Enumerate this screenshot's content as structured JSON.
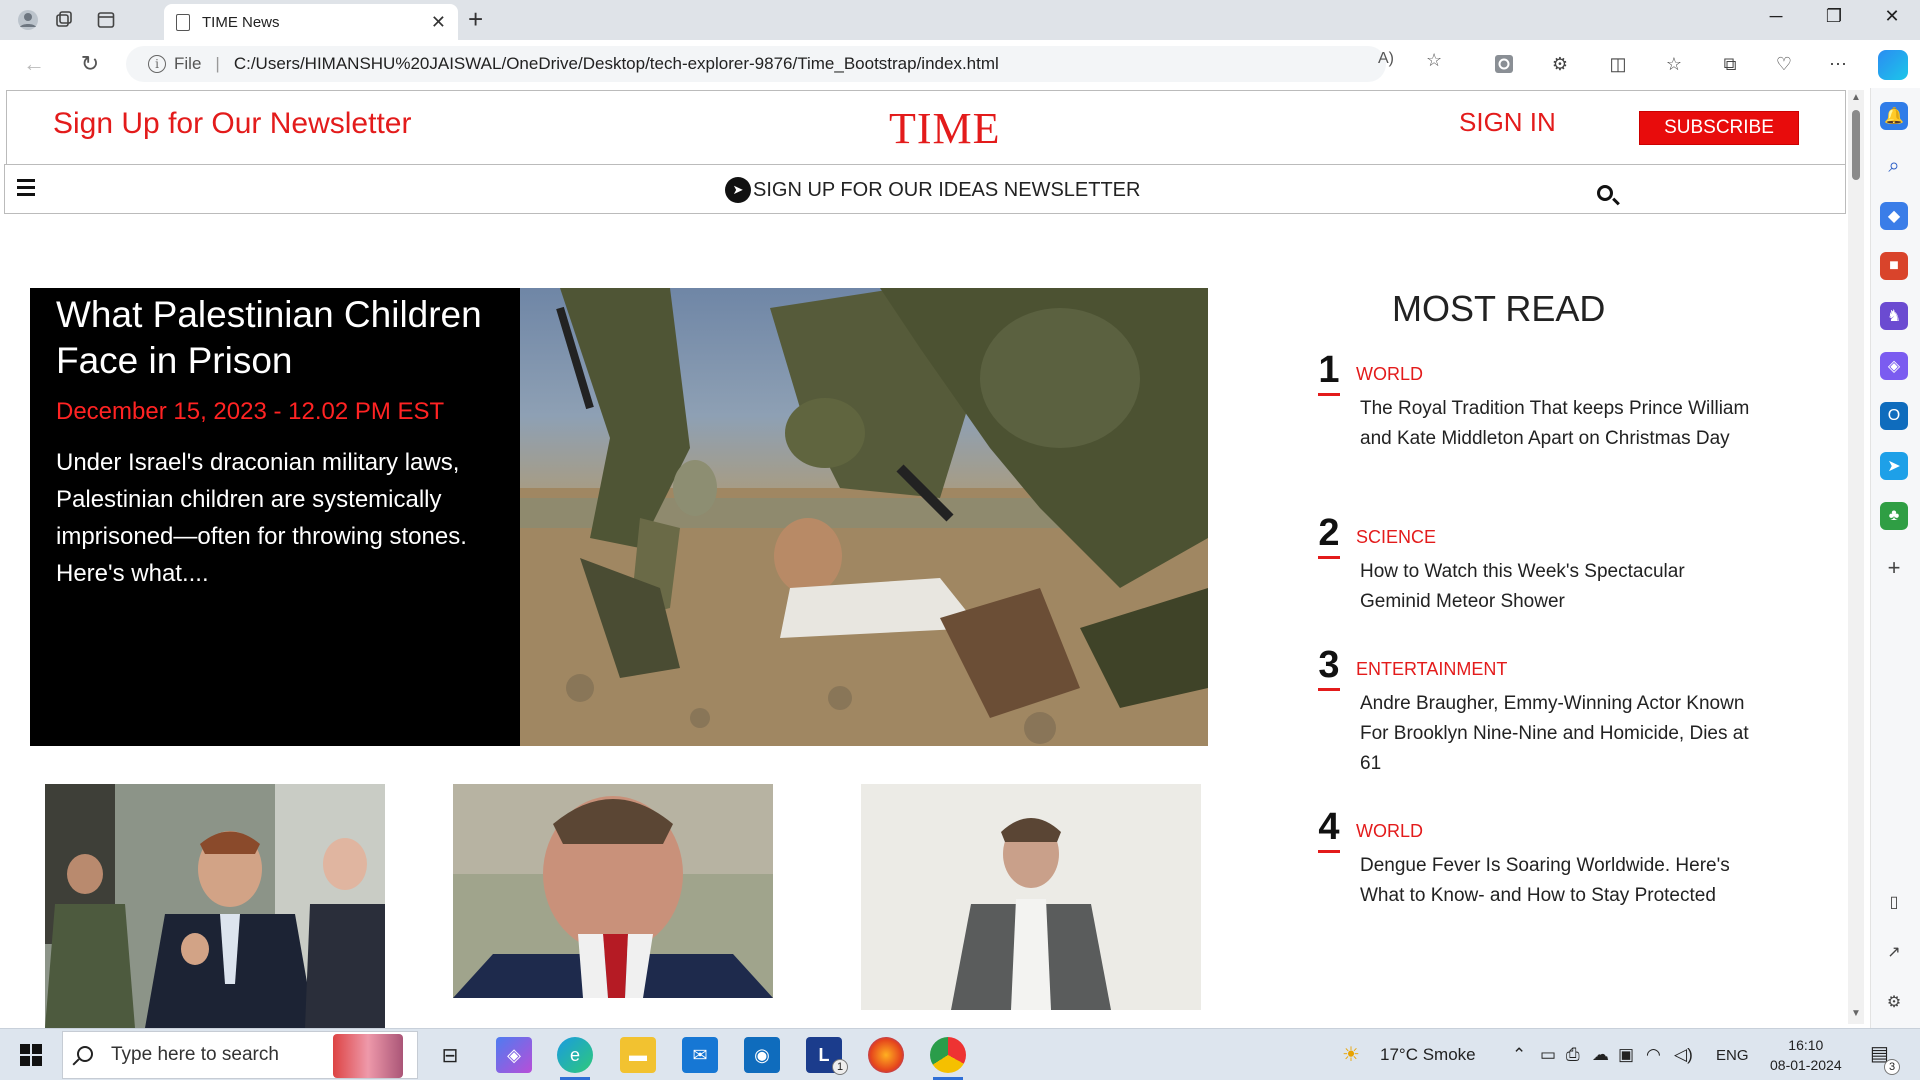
{
  "browser": {
    "tab_title": "TIME News",
    "address": {
      "scheme_label": "File",
      "url": "C:/Users/HIMANSHU%20JAISWAL/OneDrive/Desktop/tech-explorer-9876/Time_Bootstrap/index.html"
    }
  },
  "site": {
    "newsletter_link": "Sign Up for Our Newsletter",
    "logo": "TIME",
    "sign_in": "SIGN IN",
    "subscribe": "SUBSCRIBE",
    "ideas_newsletter": "SIGN UP FOR OUR IDEAS NEWSLETTER"
  },
  "hero": {
    "title": "What Palestinian Children Face in Prison",
    "date": "December 15, 2023 - 12.02 PM EST",
    "summary": "Under Israel's draconian military laws, Palestinian children are systemically imprisoned—often for throwing stones. Here's what...."
  },
  "most_read": {
    "title": "MOST READ",
    "items": [
      {
        "num": "1",
        "category": "WORLD",
        "headline": "The Royal Tradition That keeps Prince William and Kate Middleton Apart on Christmas Day"
      },
      {
        "num": "2",
        "category": "SCIENCE",
        "headline": "How to Watch this Week's Spectacular Geminid Meteor Shower"
      },
      {
        "num": "3",
        "category": "ENTERTAINMENT",
        "headline": "Andre Braugher, Emmy-Winning Actor Known For Brooklyn Nine-Nine and Homicide, Dies at 61"
      },
      {
        "num": "4",
        "category": "WORLD",
        "headline": "Dengue Fever Is Soaring Worldwide. Here's What to Know- and How to Stay Protected"
      }
    ]
  },
  "taskbar": {
    "search_placeholder": "Type here to search",
    "weather": "17°C  Smoke",
    "language": "ENG",
    "time": "16:10",
    "date": "08-01-2024",
    "notification_count": "3",
    "app_badge": "1"
  },
  "colors": {
    "brand_red": "#e31b1b",
    "subscribe_bg": "#e80c0c",
    "taskbar_bg": "#dde5ee"
  }
}
